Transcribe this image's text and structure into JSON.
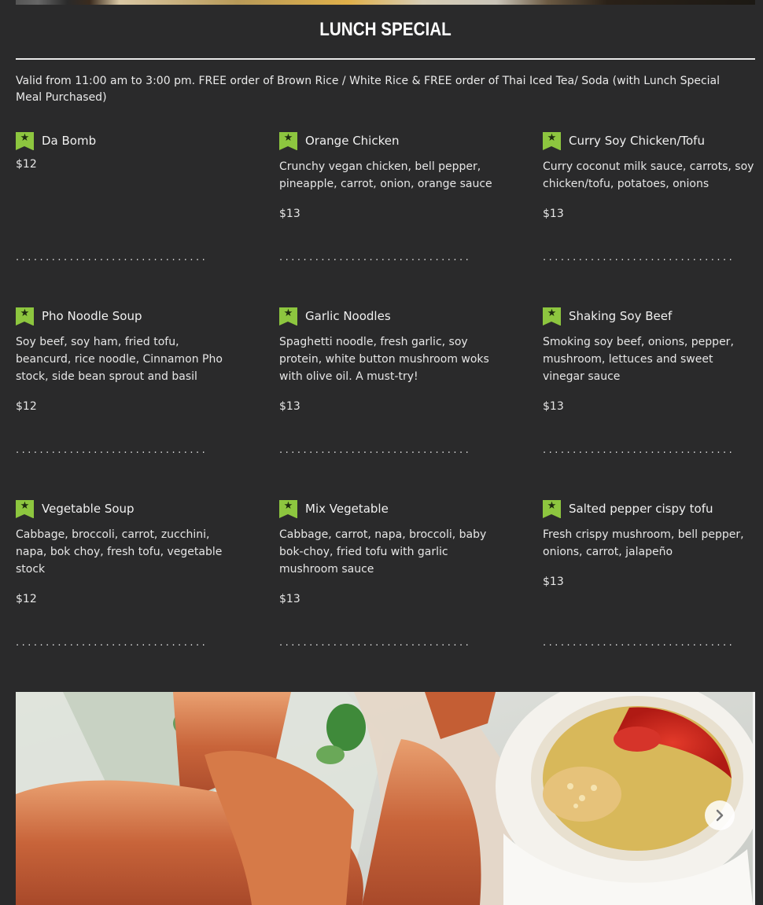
{
  "section": {
    "title": "LUNCH SPECIAL",
    "intro": "Valid from 11:00 am to 3:00 pm. FREE order of Brown Rice / White Rice & FREE order of Thai Iced Tea/ Soda (with Lunch Special Meal Purchased)"
  },
  "menu": {
    "items": [
      {
        "name": "Da Bomb",
        "description": "",
        "price": "$12"
      },
      {
        "name": "Orange Chicken",
        "description": "Crunchy vegan chicken, bell pepper, pineapple, carrot, onion, orange sauce",
        "price": "$13"
      },
      {
        "name": "Curry Soy Chicken/Tofu",
        "description": "Curry coconut milk sauce, carrots, soy chicken/tofu, potatoes, onions",
        "price": "$13"
      },
      {
        "name": "Pho Noodle Soup",
        "description": "Soy beef, soy ham, fried tofu, beancurd, rice noodle, Cinnamon Pho stock, side bean sprout and basil",
        "price": "$12"
      },
      {
        "name": "Garlic Noodles",
        "description": "Spaghetti noodle, fresh garlic, soy protein, white button mushroom woks with olive oil. A must-try!",
        "price": "$13"
      },
      {
        "name": "Shaking Soy Beef",
        "description": "Smoking soy beef, onions, pepper, mushroom, lettuces and sweet vinegar sauce",
        "price": "$13"
      },
      {
        "name": "Vegetable Soup",
        "description": "Cabbage, broccoli, carrot, zucchini, napa, bok choy, fresh tofu, vegetable stock",
        "price": "$12"
      },
      {
        "name": "Mix Vegetable",
        "description": "Cabbage, carrot, napa, broccoli, baby bok-choy, fried tofu with garlic mushroom sauce",
        "price": "$13"
      },
      {
        "name": "Salted pepper cispy tofu",
        "description": "Fresh crispy mushroom, bell pepper, onions, carrot, jalapeño",
        "price": "$13"
      }
    ],
    "divider": "................................",
    "badge_icon": "star-badge-icon"
  },
  "gallery": {
    "next_icon": "chevron-right-icon",
    "photo": "spring-rolls-with-chili-sauce-photo"
  },
  "colors": {
    "background": "#2a2a2b",
    "badge": "#8dc63f",
    "text": "#f0f0f0"
  }
}
